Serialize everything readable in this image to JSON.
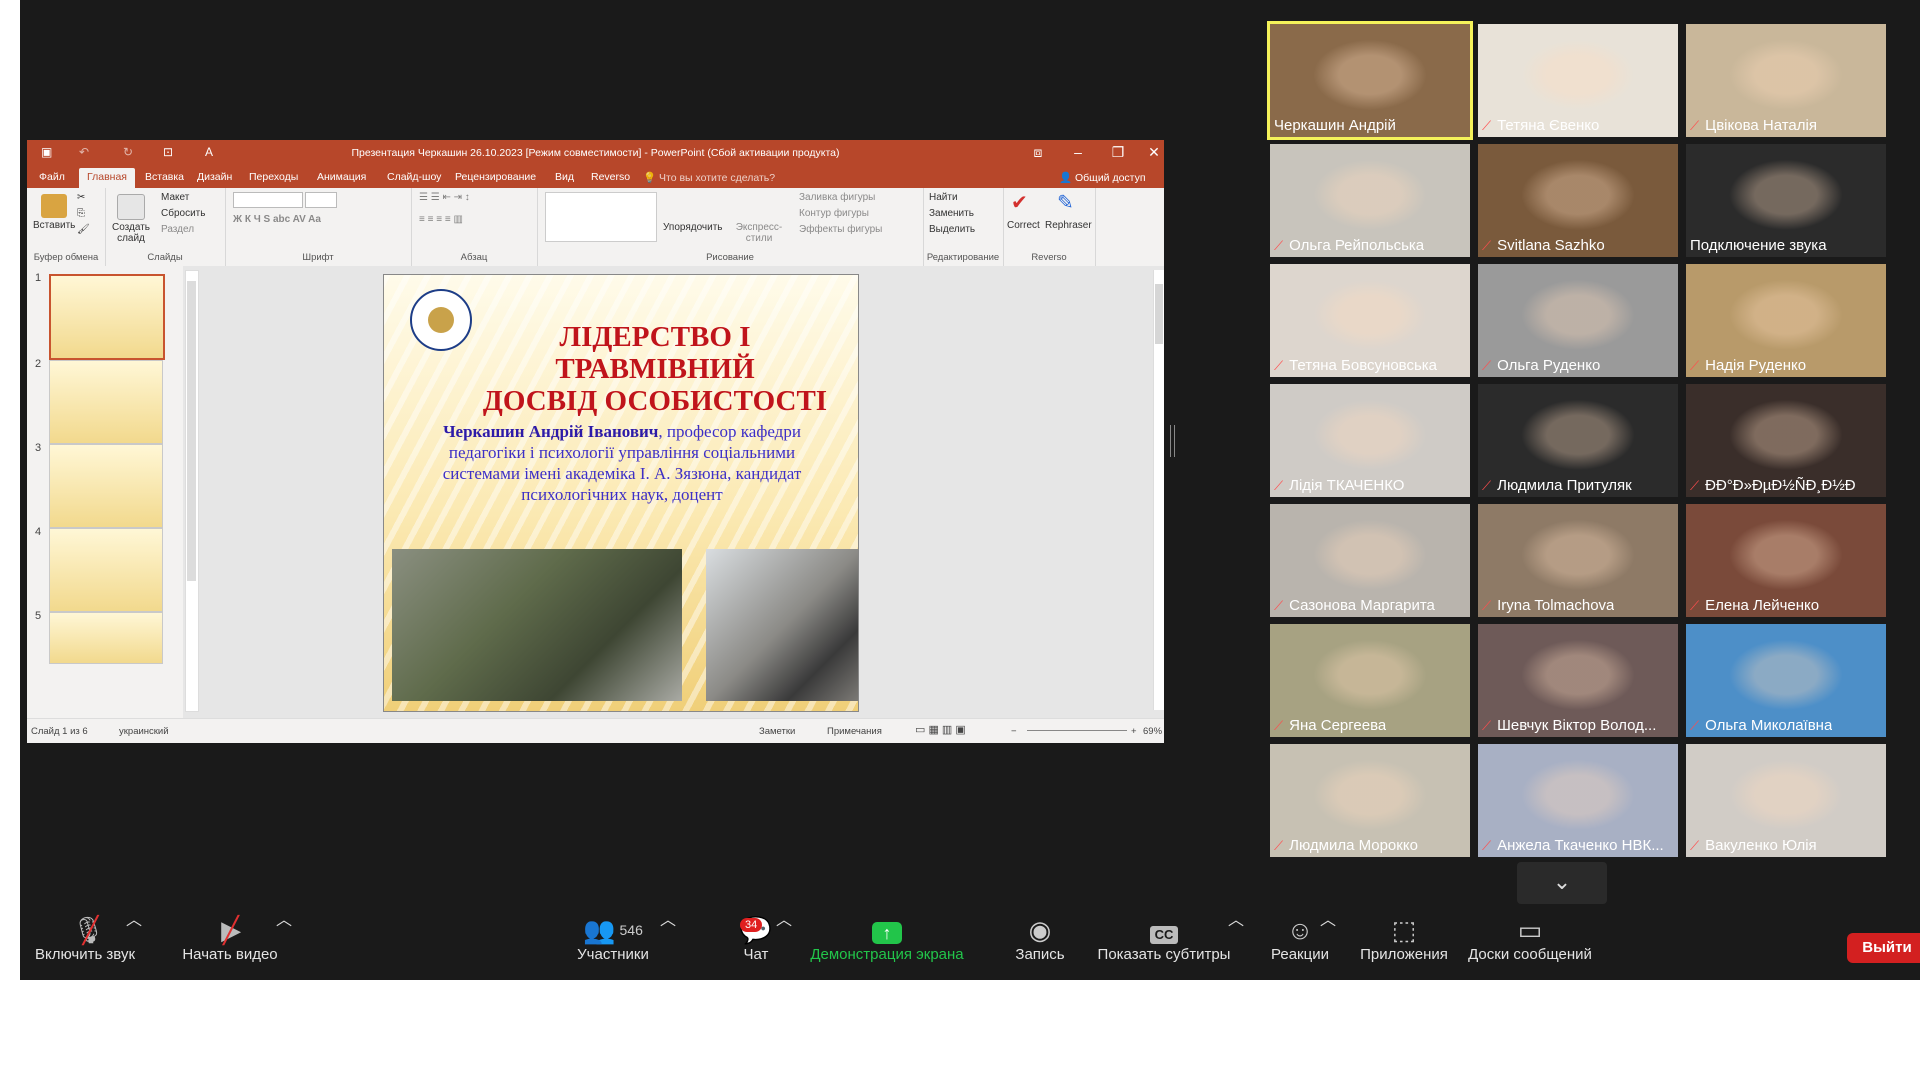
{
  "powerpoint": {
    "title": "Презентация Черкашин 26.10.2023 [Режим совместимости] - PowerPoint (Сбой активации продукта)",
    "tabs": [
      "Файл",
      "Главная",
      "Вставка",
      "Дизайн",
      "Переходы",
      "Анимация",
      "Слайд-шоу",
      "Рецензирование",
      "Вид",
      "Reverso"
    ],
    "active_tab": "Главная",
    "search_placeholder": "Что вы хотите сделать?",
    "share_label": "Общий доступ",
    "ribbon": {
      "paste": "Вставить",
      "clipboard_group": "Буфер обмена",
      "new_slide": "Создать слайд",
      "layout": "Макет",
      "reset": "Сбросить",
      "section": "Раздел",
      "slides_group": "Слайды",
      "font_group": "Шрифт",
      "paragraph_group": "Абзац",
      "arrange": "Упорядочить",
      "quick_styles": "Экспресс-стили",
      "shape_fill": "Заливка фигуры",
      "shape_outline": "Контур фигуры",
      "shape_effects": "Эффекты фигуры",
      "drawing_group": "Рисование",
      "find": "Найти",
      "replace": "Заменить",
      "select": "Выделить",
      "editing_group": "Редактирование",
      "correct": "Correct",
      "rephraser": "Rephraser",
      "reverso_group": "Reverso"
    },
    "thumbnail_numbers": [
      "1",
      "2",
      "3",
      "4",
      "5"
    ],
    "slide": {
      "title_line1": "ЛІДЕРСТВО І ТРАВМІВНИЙ",
      "title_line2": "ДОСВІД ОСОБИСТОСТІ",
      "author_name": "Черкашин Андрій Іванович",
      "author_text": ", професор кафедри педагогіки і психології управління соціальними системами імені академіка І. А. Зязюна, кандидат психологічних наук, доцент"
    },
    "status": {
      "slide_counter": "Слайд 1 из 6",
      "language": "украинский",
      "notes": "Заметки",
      "comments": "Примечания",
      "zoom": "69%"
    }
  },
  "participants_tiles": [
    {
      "name": "Черкашин Андрій",
      "muted": false,
      "active": true,
      "color": "#8a6a4a"
    },
    {
      "name": "Тетяна Євенко",
      "muted": true,
      "color": "#e8e2d8"
    },
    {
      "name": "Цвікова Наталія",
      "muted": true,
      "color": "#c9b79a"
    },
    {
      "name": "Ольга Рейпольська",
      "muted": true,
      "color": "#c8c4bc"
    },
    {
      "name": "Svitlana Sazhko",
      "muted": true,
      "color": "#7a5a3c"
    },
    {
      "name": "Подключение звука",
      "muted": false,
      "color": "#2b2b2b"
    },
    {
      "name": "Тетяна Бовсуновська",
      "muted": true,
      "color": "#ddd6ce"
    },
    {
      "name": "Ольга Руденко",
      "muted": true,
      "color": "#9a9a9a"
    },
    {
      "name": "Надія Руденко",
      "muted": true,
      "color": "#b89a6a"
    },
    {
      "name": "Лідія ТКАЧЕНКО",
      "muted": true,
      "color": "#cfcbc6"
    },
    {
      "name": "Людмила Притуляк",
      "muted": true,
      "color": "#2b2b2b"
    },
    {
      "name": "ÐÐ°Ð»ÐµÐ½ÑÐ¸Ð½Ð",
      "muted": true,
      "color": "#3a2e2a"
    },
    {
      "name": "Сазонова Маргарита",
      "muted": true,
      "color": "#b9b4ad"
    },
    {
      "name": "Iryna Tolmachova",
      "muted": true,
      "color": "#8e7a66"
    },
    {
      "name": "Елена Лейченко",
      "muted": true,
      "color": "#7a4a3a"
    },
    {
      "name": "Яна Сергеева",
      "muted": true,
      "color": "#a7a282"
    },
    {
      "name": "Шевчук Віктор Волод...",
      "muted": true,
      "color": "#6e5a58"
    },
    {
      "name": "Ольга Миколаївна",
      "muted": true,
      "color": "#4d8fc8"
    },
    {
      "name": "Людмила Морокко",
      "muted": true,
      "color": "#c7c1b3"
    },
    {
      "name": "Анжела Ткаченко НВК...",
      "muted": true,
      "color": "#a8b0c4"
    },
    {
      "name": "Вакуленко Юлія",
      "muted": true,
      "color": "#d1ccc6"
    }
  ],
  "toolbar": {
    "unmute": "Включить звук",
    "start_video": "Начать видео",
    "participants": "Участники",
    "participants_count": "546",
    "chat": "Чат",
    "chat_badge": "34",
    "share": "Демонстрация экрана",
    "record": "Запись",
    "captions": "Показать субтитры",
    "captions_icon_text": "CC",
    "reactions": "Реакции",
    "apps": "Приложения",
    "whiteboards": "Доски сообщений",
    "leave": "Выйти"
  },
  "colors": {
    "zoom_bg": "#1a1a1a",
    "powerpoint_accent": "#b7472a",
    "share_green": "#22c54a",
    "leave_red": "#d32020",
    "active_speaker_border": "#f5f25a"
  }
}
